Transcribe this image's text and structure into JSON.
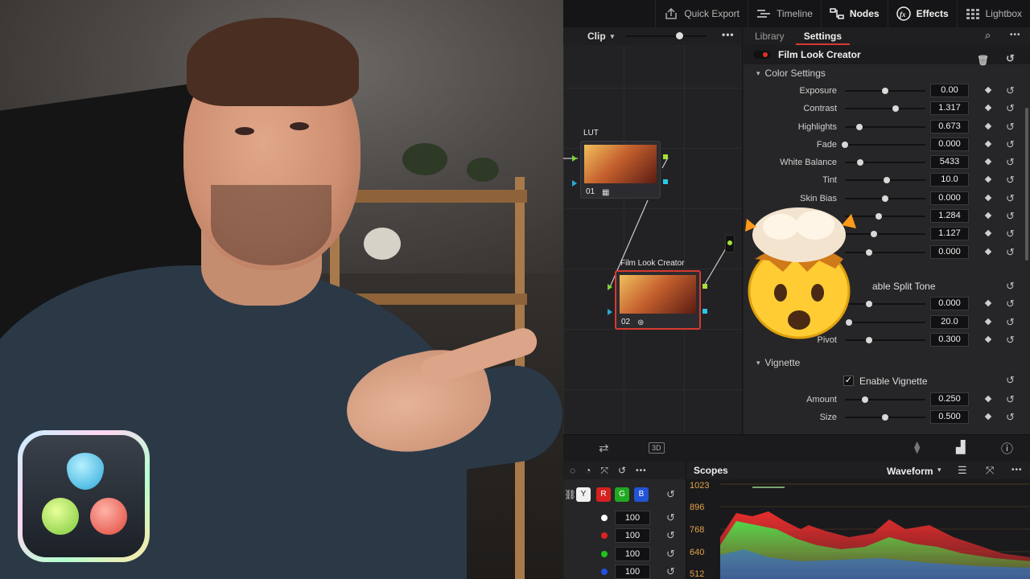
{
  "topbar": {
    "items": [
      {
        "label": "Quick Export",
        "icon": "export-icon"
      },
      {
        "label": "Timeline",
        "icon": "timeline-icon"
      },
      {
        "label": "Nodes",
        "icon": "nodes-icon"
      },
      {
        "label": "Effects",
        "icon": "fx-icon"
      },
      {
        "label": "Lightbox",
        "icon": "grid-icon"
      }
    ]
  },
  "node_editor": {
    "mode": "Clip",
    "nodes": [
      {
        "label": "LUT",
        "number": "01"
      },
      {
        "label": "Film Look Creator",
        "number": "02"
      }
    ]
  },
  "inspector": {
    "tabs": [
      "Library",
      "Settings"
    ],
    "effect_name": "Film Look Creator",
    "color_section": "Color Settings",
    "color_rows": [
      {
        "label": "Exposure",
        "value": "0.00",
        "pos": 0.5
      },
      {
        "label": "Contrast",
        "value": "1.317",
        "pos": 0.63
      },
      {
        "label": "Highlights",
        "value": "0.673",
        "pos": 0.18
      },
      {
        "label": "Fade",
        "value": "0.000",
        "pos": 0.0
      },
      {
        "label": "White Balance",
        "value": "5433",
        "pos": 0.19
      },
      {
        "label": "Tint",
        "value": "10.0",
        "pos": 0.52
      },
      {
        "label": "Skin Bias",
        "value": "0.000",
        "pos": 0.5
      },
      {
        "label": "",
        "value": "1.284",
        "pos": 0.42
      },
      {
        "label": "",
        "value": "1.127",
        "pos": 0.36
      },
      {
        "label": "",
        "value": "0.000",
        "pos": 0.3
      }
    ],
    "split_tone_label": "able Split Tone",
    "split_rows": [
      {
        "label": "",
        "value": "0.000",
        "pos": 0.3
      },
      {
        "label": "",
        "value": "20.0",
        "pos": 0.05
      },
      {
        "label": "Pivot",
        "value": "0.300",
        "pos": 0.3
      }
    ],
    "vignette_section": "Vignette",
    "enable_vignette": "Enable Vignette",
    "vignette_rows": [
      {
        "label": "Amount",
        "value": "0.250",
        "pos": 0.25
      },
      {
        "label": "Size",
        "value": "0.500",
        "pos": 0.5
      }
    ]
  },
  "midbar": {
    "label_3d": "3D"
  },
  "curves": {
    "channels": [
      "Y",
      "R",
      "G",
      "B"
    ],
    "rows": [
      {
        "color": "#ffffff",
        "value": "100"
      },
      {
        "color": "#e02020",
        "value": "100"
      },
      {
        "color": "#20c020",
        "value": "100"
      },
      {
        "color": "#2050e0",
        "value": "100"
      }
    ]
  },
  "scopes": {
    "title": "Scopes",
    "mode": "Waveform",
    "y_labels": [
      "1023",
      "896",
      "768",
      "640",
      "512"
    ]
  },
  "colors": {
    "accent": "#d63a2f",
    "label_orange": "#e4a34a"
  }
}
